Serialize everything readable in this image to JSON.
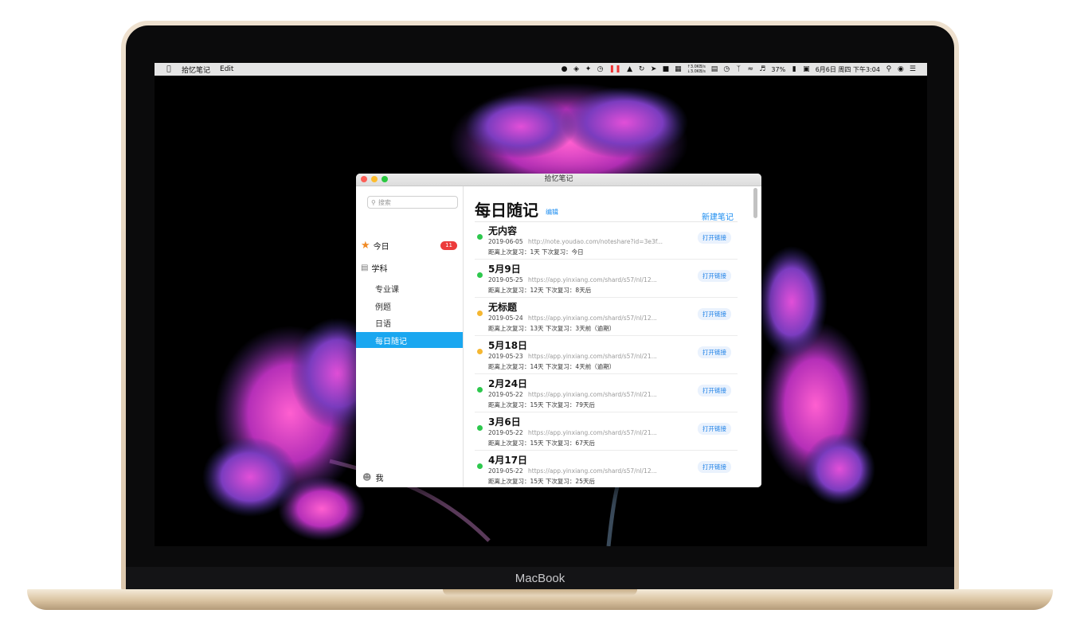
{
  "device": {
    "brand": "MacBook"
  },
  "menubar": {
    "apple_icon": "apple-icon",
    "app_name": "拾忆笔记",
    "menu_edit": "Edit",
    "net_up": "↑3.0KB/s",
    "net_down": "↓3.0KB/s",
    "battery": "37%",
    "clock": "6月6日 周四 下午3:04",
    "icons": [
      "qq-icon",
      "evernote-icon",
      "bird-icon",
      "clock-icon",
      "pause-icon",
      "flame-icon",
      "history-icon",
      "send-icon",
      "elephant-icon",
      "grid-icon",
      "battery-monitor-icon",
      "time-machine-icon",
      "bluetooth-icon",
      "wifi-icon",
      "volume-icon",
      "control-icon",
      "search-icon",
      "siri-icon",
      "notification-icon"
    ]
  },
  "window": {
    "title": "拾忆笔记"
  },
  "sidebar": {
    "search_placeholder": "搜索",
    "today": {
      "label": "今日",
      "badge": "11"
    },
    "subject": {
      "label": "学科"
    },
    "subjects": [
      {
        "label": "专业课",
        "selected": false
      },
      {
        "label": "例题",
        "selected": false
      },
      {
        "label": "日语",
        "selected": false
      },
      {
        "label": "每日随记",
        "selected": true
      }
    ],
    "me": {
      "label": "我"
    }
  },
  "main": {
    "title": "每日随记",
    "edit_label": "编辑",
    "new_note_label": "新建笔记",
    "open_link_label": "打开链接",
    "notes": [
      {
        "title": "无内容",
        "date": "2019-06-05",
        "url": "http://note.youdao.com/noteshare?id=3e3f...",
        "review": "距离上次复习：1天 下次复习：今日",
        "status_color": "#2dc84d"
      },
      {
        "title": "5月9日",
        "date": "2019-05-25",
        "url": "https://app.yinxiang.com/shard/s57/nl/12...",
        "review": "距离上次复习：12天 下次复习：8天后",
        "status_color": "#2dc84d"
      },
      {
        "title": "无标题",
        "date": "2019-05-24",
        "url": "https://app.yinxiang.com/shard/s57/nl/12...",
        "review": "距离上次复习：13天 下次复习：3天前（逾期）",
        "status_color": "#f5b731"
      },
      {
        "title": "5月18日",
        "date": "2019-05-23",
        "url": "https://app.yinxiang.com/shard/s57/nl/21...",
        "review": "距离上次复习：14天 下次复习：4天前（逾期）",
        "status_color": "#f5b731"
      },
      {
        "title": "2月24日",
        "date": "2019-05-22",
        "url": "https://app.yinxiang.com/shard/s57/nl/21...",
        "review": "距离上次复习：15天 下次复习：79天后",
        "status_color": "#2dc84d"
      },
      {
        "title": "3月6日",
        "date": "2019-05-22",
        "url": "https://app.yinxiang.com/shard/s57/nl/21...",
        "review": "距离上次复习：15天 下次复习：67天后",
        "status_color": "#2dc84d"
      },
      {
        "title": "4月17日",
        "date": "2019-05-22",
        "url": "https://app.yinxiang.com/shard/s57/nl/12...",
        "review": "距离上次复习：15天 下次复习：25天后",
        "status_color": "#2dc84d"
      }
    ]
  },
  "colors": {
    "accent": "#1aa7f0",
    "link": "#1a8cf0",
    "badge": "#ec3b3b",
    "green": "#2dc84d",
    "orange": "#f5b731"
  }
}
